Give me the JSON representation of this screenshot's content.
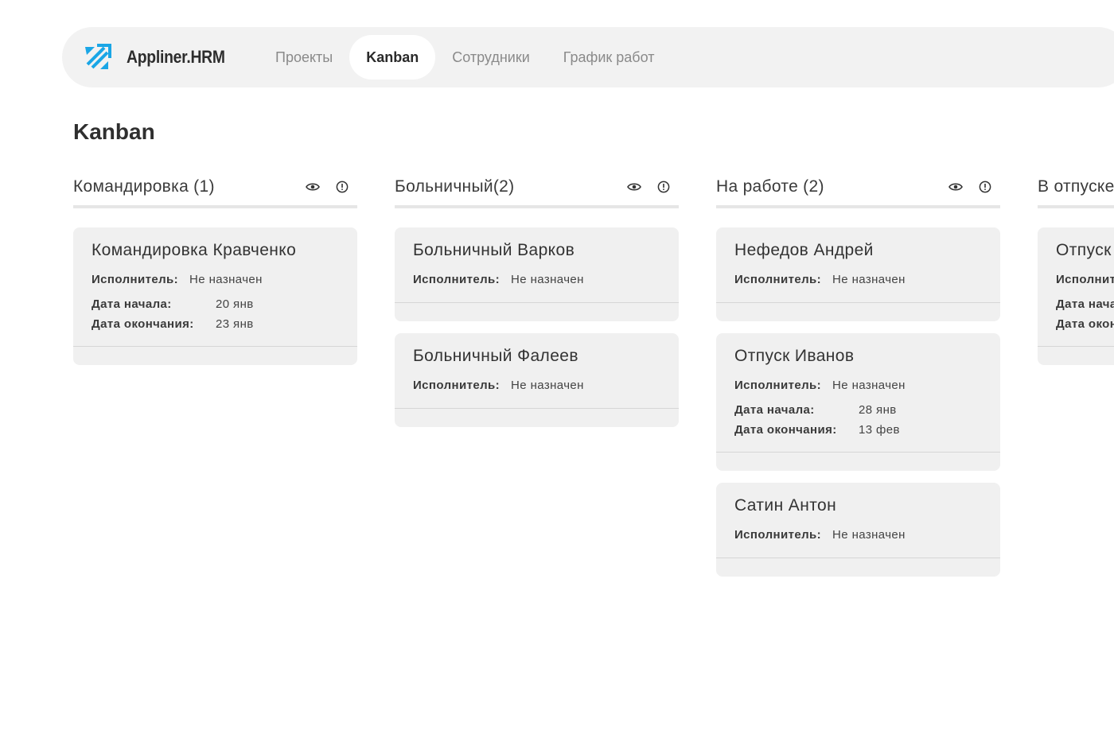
{
  "app": {
    "name": "Appliner.HRM",
    "accent": "#1aa6e6"
  },
  "nav": [
    {
      "label": "Проекты",
      "active": false
    },
    {
      "label": "Kanban",
      "active": true
    },
    {
      "label": "Сотрудники",
      "active": false
    },
    {
      "label": "График работ",
      "active": false
    }
  ],
  "page": {
    "title": "Kanban"
  },
  "labels": {
    "assignee": "Исполнитель:",
    "start": "Дата начала:",
    "end": "Дата окончания:"
  },
  "columns": [
    {
      "title": "Командировка (1)",
      "icons": [
        "eye-icon",
        "info-icon"
      ],
      "cards": [
        {
          "title": "Командировка Кравченко",
          "assignee": "Не назначен",
          "start": "20 янв",
          "end": "23 янв"
        }
      ]
    },
    {
      "title": "Больничный(2)",
      "icons": [
        "eye-icon",
        "info-icon"
      ],
      "cards": [
        {
          "title": "Больничный Варков",
          "assignee": "Не назначен"
        },
        {
          "title": "Больничный Фалеев",
          "assignee": "Не назначен"
        }
      ]
    },
    {
      "title": "На работе (2)",
      "icons": [
        "eye-icon",
        "info-icon"
      ],
      "cards": [
        {
          "title": "Нефедов Андрей",
          "assignee": "Не назначен"
        },
        {
          "title": "Отпуск Иванов",
          "assignee": "Не назначен",
          "start": "28 янв",
          "end": "13 фев"
        },
        {
          "title": "Сатин Антон",
          "assignee": "Не назначен"
        }
      ]
    },
    {
      "title": "В отпуске",
      "icons": [],
      "cards": [
        {
          "title": "Отпуск",
          "assignee": "",
          "start": "",
          "end": ""
        }
      ]
    }
  ]
}
